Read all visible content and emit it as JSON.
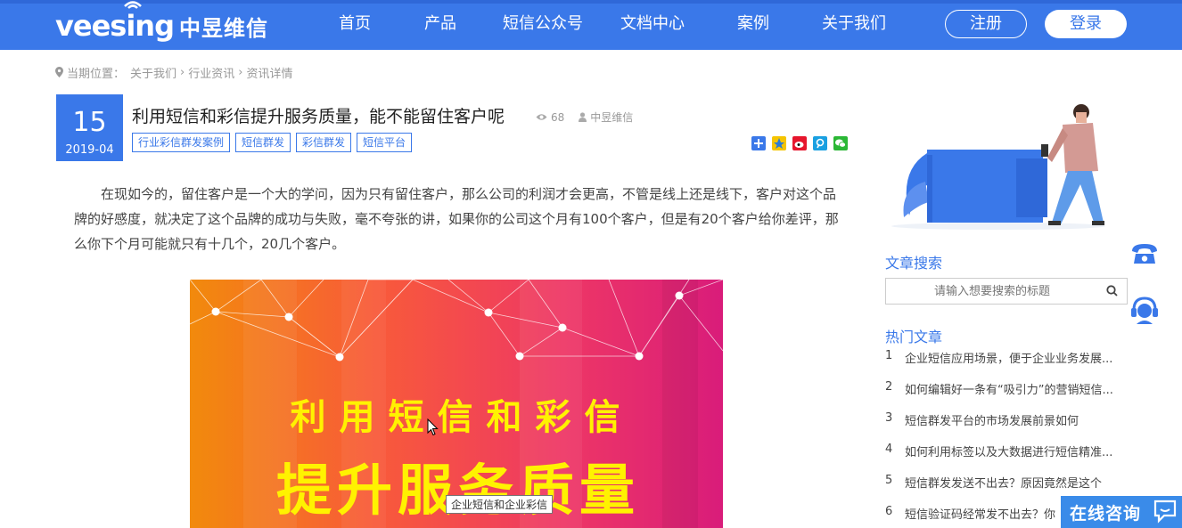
{
  "header": {
    "logo_en": "veesing",
    "logo_cn": "中昱维信",
    "nav": [
      "首页",
      "产品",
      "短信公众号",
      "文档中心",
      "案例",
      "关于我们"
    ],
    "register": "注册",
    "login": "登录",
    "brand_color": "#3a78e9"
  },
  "breadcrumb": {
    "label": "当期位置：",
    "items": [
      "关于我们",
      "行业资讯",
      "资讯详情"
    ]
  },
  "article": {
    "day": "15",
    "year_month": "2019-04",
    "title": "利用短信和彩信提升服务质量，能不能留住客户呢",
    "views": "68",
    "author": "中昱维信",
    "tags": [
      "行业彩信群发案例",
      "短信群发",
      "彩信群发",
      "短信平台"
    ],
    "share_icons": [
      "share-more-icon",
      "qzone-icon",
      "weibo-icon",
      "tencent-weibo-icon",
      "wechat-icon"
    ],
    "paragraph": "在现如今的，留住客户是一个大的学问，因为只有留住客户，那么公司的利润才会更高，不管是线上还是线下，客户对这个品牌的好感度，就决定了这个品牌的成功与失败，毫不夸张的讲，如果你的公司这个月有100个客户，但是有20个客户给你差评，那么你下个月可能就只有十几个，20几个客户。",
    "banner_line1": "利用短信和彩信",
    "banner_line2": "提升服务质量",
    "tooltip": "企业短信和企业彩信"
  },
  "sidebar": {
    "search_title": "文章搜索",
    "search_placeholder": "请输入想要搜索的标题",
    "hot_title": "热门文章",
    "hot_articles": [
      {
        "num": "1",
        "title": "企业短信应用场景，便于企业业务发展..."
      },
      {
        "num": "2",
        "title": "如何编辑好一条有“吸引力”的营销短信..."
      },
      {
        "num": "3",
        "title": "短信群发平台的市场发展前景如何"
      },
      {
        "num": "4",
        "title": "如何利用标签以及大数据进行短信精准..."
      },
      {
        "num": "5",
        "title": "短信群发发送不出去？原因竟然是这个"
      },
      {
        "num": "6",
        "title": "短信验证码经常发不出去？你"
      }
    ]
  },
  "float": {
    "online_consult": "在线咨询"
  }
}
